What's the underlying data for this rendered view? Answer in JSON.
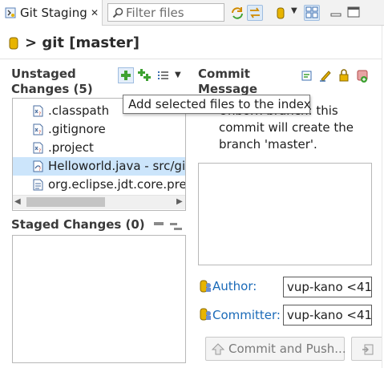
{
  "tab": {
    "title": "Git Staging",
    "close": "✕"
  },
  "toolbar": {
    "filter_placeholder": "Filter files"
  },
  "repo": {
    "title": "> git [master]"
  },
  "unstaged": {
    "title_line1": "Unstaged",
    "title_line2": "Changes (5)",
    "files": [
      {
        "label": ".classpath",
        "selected": false
      },
      {
        "label": ".gitignore",
        "selected": false
      },
      {
        "label": ".project",
        "selected": false
      },
      {
        "label": "Helloworld.java - src/gi",
        "selected": true
      },
      {
        "label": "org.eclipse.jdt.core.pre",
        "selected": false
      }
    ]
  },
  "staged": {
    "title": "Staged Changes (0)"
  },
  "commit": {
    "title_line1": "Commit",
    "title_line2": "Message",
    "info_line1": "Unborn branch: this",
    "info_line2": "commit will create the",
    "info_line3": "branch 'master'.",
    "author_label": "Author:",
    "author_value": "vup-kano <41",
    "committer_label": "Committer:",
    "committer_value": "vup-kano <41",
    "commit_push_label": "Commit and Push..."
  },
  "tooltip": {
    "text": "Add selected files to the index"
  },
  "colors": {
    "accent": "#1a6ab8",
    "selection": "#cce5fb",
    "icon_green": "#3ea132",
    "icon_yellow": "#e8b400"
  }
}
